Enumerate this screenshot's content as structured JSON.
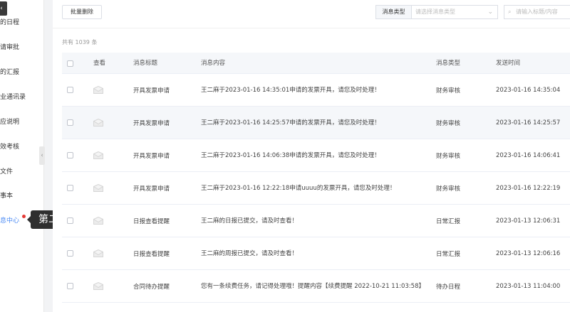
{
  "sidebar": {
    "items": [
      {
        "label": "的日程",
        "active": false
      },
      {
        "label": "请审批",
        "active": false
      },
      {
        "label": "的汇报",
        "active": false
      },
      {
        "label": "业通讯录",
        "active": false
      },
      {
        "label": "应说明",
        "active": false
      },
      {
        "label": "效考核",
        "active": false
      },
      {
        "label": "文件",
        "active": false
      },
      {
        "label": "事本",
        "active": false
      },
      {
        "label": "息中心",
        "active": true
      }
    ],
    "tooltip": "第二步",
    "accent_color": "#4a8af4",
    "badge_color": "#e53935"
  },
  "toolbar": {
    "batch_delete": "批量删除",
    "filter_label": "消息类型",
    "filter_placeholder": "请选择消息类型",
    "search_placeholder": "请输入标题/内容"
  },
  "summary": {
    "total_text": "共有 1039 条"
  },
  "table": {
    "headers": {
      "view": "查看",
      "title": "消息标题",
      "content": "消息内容",
      "type": "消息类型",
      "time": "发送时间"
    },
    "rows": [
      {
        "title": "开具发票申请",
        "content": "王二麻于2023-01-16 14:35:01申请的发票开具，请您及时处理！",
        "type": "财务审核",
        "time": "2023-01-16 14:35:04"
      },
      {
        "title": "开具发票申请",
        "content": "王二麻于2023-01-16 14:25:57申请的发票开具，请您及时处理！",
        "type": "财务审核",
        "time": "2023-01-16 14:25:57"
      },
      {
        "title": "开具发票申请",
        "content": "王二麻于2023-01-16 14:06:38申请的发票开具，请您及时处理！",
        "type": "财务审核",
        "time": "2023-01-16 14:06:41"
      },
      {
        "title": "开具发票申请",
        "content": "王二麻于2023-01-16 12:22:18申请uuuu的发票开具，请您及时处理！",
        "type": "财务审核",
        "time": "2023-01-16 12:22:19"
      },
      {
        "title": "日报查看提醒",
        "content": "王二麻的日报已提交，请及时查看！",
        "type": "日常汇报",
        "time": "2023-01-13 12:06:31"
      },
      {
        "title": "日报查看提醒",
        "content": "王二麻的周报已提交，请及时查看！",
        "type": "日常汇报",
        "time": "2023-01-13 12:06:16"
      },
      {
        "title": "合同待办提醒",
        "content": "您有一条续费任务，请记得处理哦！提醒内容【续费提醒 2022-10-21 11:03:58】",
        "type": "待办日程",
        "time": "2023-01-13 11:04:00"
      }
    ]
  }
}
